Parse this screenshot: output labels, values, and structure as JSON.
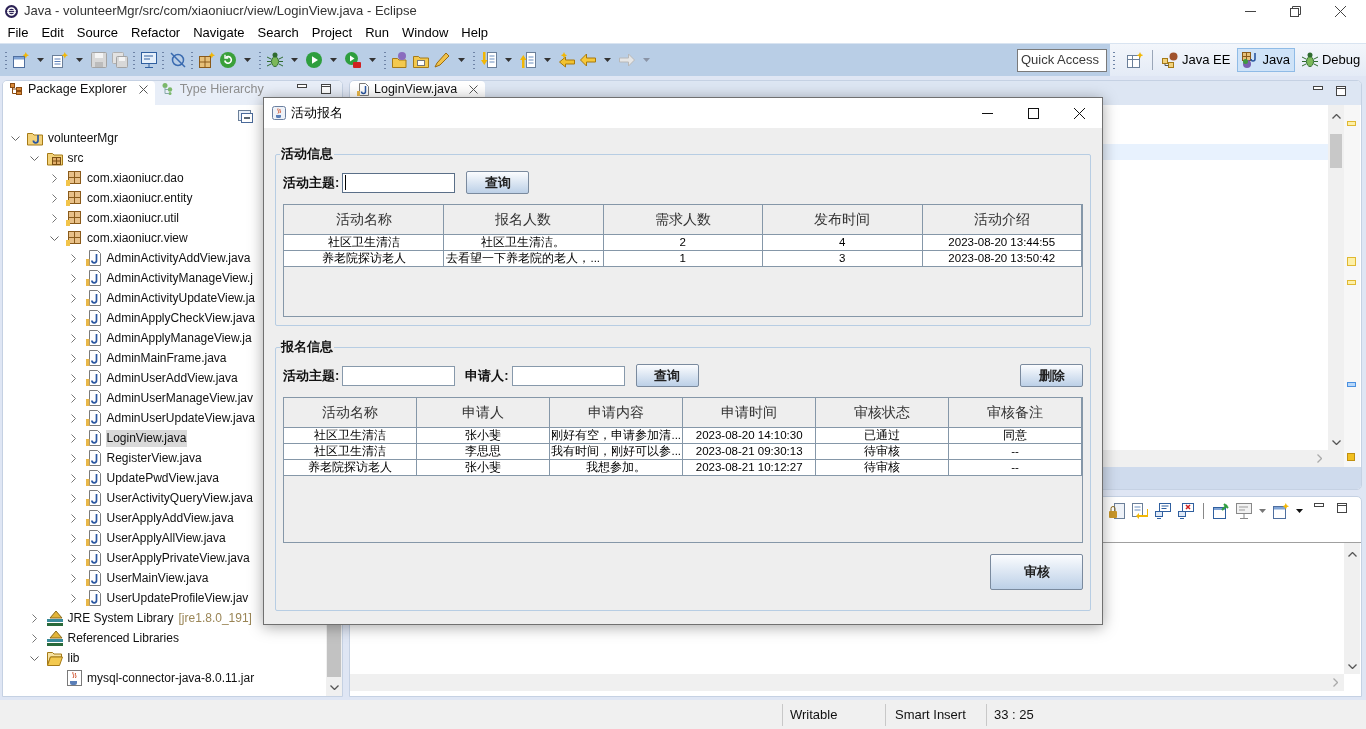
{
  "window": {
    "title": "Java - volunteerMgr/src/com/xiaoniucr/view/LoginView.java - Eclipse"
  },
  "menu": [
    "File",
    "Edit",
    "Source",
    "Refactor",
    "Navigate",
    "Search",
    "Project",
    "Run",
    "Window",
    "Help"
  ],
  "toolbar": {
    "quick_access": {
      "placeholder": "Quick Access"
    },
    "perspectives": [
      {
        "label": "Java EE",
        "kind": "javaee",
        "selected": false
      },
      {
        "label": "Java",
        "kind": "java",
        "selected": true
      },
      {
        "label": "Debug",
        "kind": "debug",
        "selected": false
      }
    ]
  },
  "package_explorer": {
    "tabs": [
      {
        "label": "Package Explorer",
        "kind": "packages",
        "selected": true
      },
      {
        "label": "Type Hierarchy",
        "kind": "hierarchy",
        "selected": false
      }
    ],
    "tree": [
      {
        "label": "volunteerMgr",
        "kind": "project",
        "expanded": true,
        "selected": false,
        "children": [
          {
            "label": "src",
            "kind": "source-folder",
            "expanded": true,
            "selected": false,
            "children": [
              {
                "label": "com.xiaoniucr.dao",
                "kind": "package",
                "expanded": false,
                "selected": false
              },
              {
                "label": "com.xiaoniucr.entity",
                "kind": "package",
                "expanded": false,
                "selected": false
              },
              {
                "label": "com.xiaoniucr.util",
                "kind": "package",
                "expanded": false,
                "selected": false
              },
              {
                "label": "com.xiaoniucr.view",
                "kind": "package",
                "expanded": true,
                "selected": false,
                "children": [
                  {
                    "label": "AdminActivityAddView.java",
                    "kind": "java-file",
                    "expanded": false,
                    "selected": false
                  },
                  {
                    "label": "AdminActivityManageView.j",
                    "kind": "java-file",
                    "expanded": false,
                    "selected": false
                  },
                  {
                    "label": "AdminActivityUpdateView.ja",
                    "kind": "java-file",
                    "expanded": false,
                    "selected": false
                  },
                  {
                    "label": "AdminApplyCheckView.java",
                    "kind": "java-file",
                    "expanded": false,
                    "selected": false
                  },
                  {
                    "label": "AdminApplyManageView.ja",
                    "kind": "java-file",
                    "expanded": false,
                    "selected": false
                  },
                  {
                    "label": "AdminMainFrame.java",
                    "kind": "java-file",
                    "expanded": false,
                    "selected": false
                  },
                  {
                    "label": "AdminUserAddView.java",
                    "kind": "java-file",
                    "expanded": false,
                    "selected": false
                  },
                  {
                    "label": "AdminUserManageView.jav",
                    "kind": "java-file",
                    "expanded": false,
                    "selected": false
                  },
                  {
                    "label": "AdminUserUpdateView.java",
                    "kind": "java-file",
                    "expanded": false,
                    "selected": false
                  },
                  {
                    "label": "LoginView.java",
                    "kind": "java-file",
                    "expanded": false,
                    "selected": true
                  },
                  {
                    "label": "RegisterView.java",
                    "kind": "java-file",
                    "expanded": false,
                    "selected": false
                  },
                  {
                    "label": "UpdatePwdView.java",
                    "kind": "java-file",
                    "expanded": false,
                    "selected": false
                  },
                  {
                    "label": "UserActivityQueryView.java",
                    "kind": "java-file",
                    "expanded": false,
                    "selected": false
                  },
                  {
                    "label": "UserApplyAddView.java",
                    "kind": "java-file",
                    "expanded": false,
                    "selected": false
                  },
                  {
                    "label": "UserApplyAllView.java",
                    "kind": "java-file",
                    "expanded": false,
                    "selected": false
                  },
                  {
                    "label": "UserApplyPrivateView.java",
                    "kind": "java-file",
                    "expanded": false,
                    "selected": false
                  },
                  {
                    "label": "UserMainView.java",
                    "kind": "java-file",
                    "expanded": false,
                    "selected": false
                  },
                  {
                    "label": "UserUpdateProfileView.jav",
                    "kind": "java-file",
                    "expanded": false,
                    "selected": false
                  }
                ]
              }
            ]
          },
          {
            "label": "JRE System Library",
            "decoration": "[jre1.8.0_191]",
            "kind": "library",
            "expanded": false,
            "selected": false
          },
          {
            "label": "Referenced Libraries",
            "kind": "library",
            "expanded": false,
            "selected": false
          },
          {
            "label": "lib",
            "kind": "folder",
            "expanded": true,
            "selected": false,
            "children": [
              {
                "label": "mysql-connector-java-8.0.11.jar",
                "kind": "jar",
                "selected": false
              }
            ]
          }
        ]
      }
    ]
  },
  "editor": {
    "tabs": [
      {
        "label": "LoginView.java",
        "selected": true
      }
    ]
  },
  "dialog": {
    "title": "活动报名",
    "groups": [
      {
        "title": "活动信息",
        "fields": [
          {
            "label": "活动主题:",
            "focused": true
          }
        ],
        "buttons": [
          {
            "label": "查询",
            "kind": "query"
          }
        ],
        "table": {
          "columns": [
            "活动名称",
            "报名人数",
            "需求人数",
            "发布时间",
            "活动介绍"
          ],
          "rows": [
            [
              "社区卫生清洁",
              "社区卫生清洁。",
              "2",
              "4",
              "2023-08-20 13:44:55"
            ],
            [
              "养老院探访老人",
              "去看望一下养老院的老人，...",
              "1",
              "3",
              "2023-08-20 13:50:42"
            ]
          ]
        }
      },
      {
        "title": "报名信息",
        "fields": [
          {
            "label": "活动主题:",
            "focused": false
          },
          {
            "label": "申请人:",
            "focused": false
          }
        ],
        "buttons": [
          {
            "label": "查询",
            "kind": "query"
          },
          {
            "label": "删除",
            "kind": "delete"
          }
        ],
        "table": {
          "columns": [
            "活动名称",
            "申请人",
            "申请内容",
            "申请时间",
            "审核状态",
            "审核备注"
          ],
          "rows": [
            [
              "社区卫生清洁",
              "张小斐",
              "刚好有空，申请参加清...",
              "2023-08-20 14:10:30",
              "已通过",
              "同意"
            ],
            [
              "社区卫生清洁",
              "李思思",
              "我有时间，刚好可以参...",
              "2023-08-21 09:30:13",
              "待审核",
              "--"
            ],
            [
              "养老院探访老人",
              "张小斐",
              "我想参加。",
              "2023-08-21 10:12:27",
              "待审核",
              "--"
            ]
          ]
        },
        "footer_buttons": [
          {
            "label": "审核"
          }
        ]
      }
    ]
  },
  "status_bar": [
    "Writable",
    "Smart Insert",
    "33 : 25"
  ]
}
